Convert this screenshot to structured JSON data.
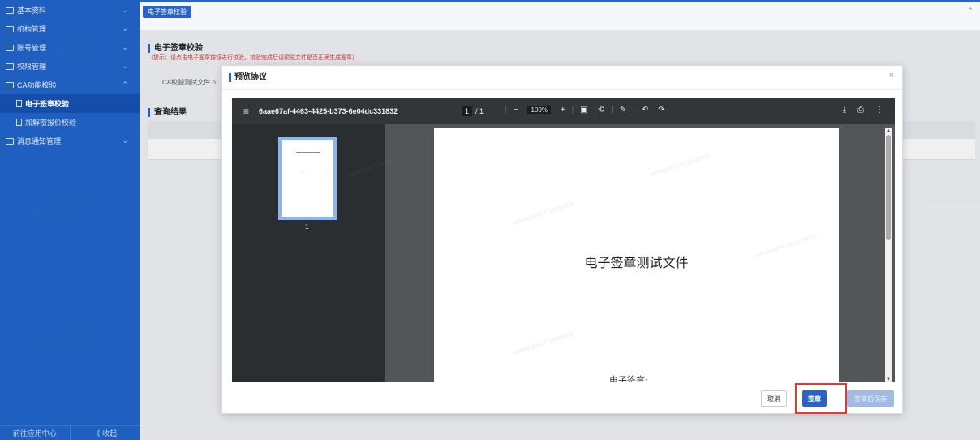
{
  "sidebar": {
    "items": [
      {
        "label": "基本资料"
      },
      {
        "label": "机构管理"
      },
      {
        "label": "账号管理"
      },
      {
        "label": "权限管理"
      },
      {
        "label": "CA功能校验"
      },
      {
        "label": "消息通知管理"
      }
    ],
    "sub_items": [
      {
        "label": "电子签章校验",
        "active": true
      },
      {
        "label": "加解密报价校验",
        "active": false
      }
    ],
    "footer": {
      "left": "前往应用中心",
      "right": "《 收起"
    }
  },
  "tabs": [
    {
      "label": "电子签章校验"
    }
  ],
  "page": {
    "section_title": "电子签章校验",
    "hint": "（提示：请点击电子签章按钮进行校验，校验完成后请预览文件是否正确生成签章）",
    "file_label": "CA校验测试文件.p",
    "results_title": "查询结果"
  },
  "modal": {
    "title": "预览协议",
    "close": "×",
    "buttons": {
      "cancel": "取消",
      "sign": "签章",
      "sign_and_save": "签章后保存"
    }
  },
  "pdf": {
    "file_name": "6aae67af-4463-4425-b373-6e04dc331832",
    "current_page": "1",
    "total_pages": "/ 1",
    "zoom": "100%",
    "thumb_page": "1",
    "doc_title": "电子签章测试文件",
    "doc_sign": "电子签章:"
  },
  "watermark": {
    "text": "adminp@SC4214000001"
  },
  "colors": {
    "sidebar": "#1f5fbf",
    "primary": "#2a63c7",
    "highlight": "#e53935",
    "hint": "#d23b3b"
  }
}
